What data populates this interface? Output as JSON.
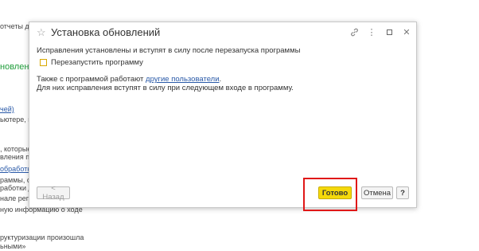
{
  "background": {
    "fragments": [
      {
        "text": "отчеты для",
        "style": "plain"
      },
      {
        "text": "новление",
        "style": "green"
      },
      {
        "text": "чей)",
        "style": "link"
      },
      {
        "text": "ьютере, в с",
        "style": "plain"
      },
      {
        "text": ", которые д",
        "style": "plain"
      },
      {
        "text": "вления прог",
        "style": "plain"
      },
      {
        "text": "обработка",
        "style": "link"
      },
      {
        "text": "раммы, от",
        "style": "plain"
      },
      {
        "text": "работки да",
        "style": "plain"
      },
      {
        "text": "нале регис",
        "style": "plain"
      },
      {
        "text": "ную информацию о ходе",
        "style": "plain"
      },
      {
        "text": "руктуризации произошла",
        "style": "plain"
      },
      {
        "text": "ьными»",
        "style": "plain"
      }
    ]
  },
  "dialog": {
    "title": "Установка обновлений",
    "message_line1": "Исправления установлены и вступят в силу после перезапуска программы",
    "restart_checkbox_label": "Перезапустить программу",
    "restart_checked": false,
    "info_prefix": "Также с программой работают ",
    "info_link": "другие пользователи",
    "info_suffix": ".",
    "info_line2": "Для них исправления вступят в силу при следующем входе в программу.",
    "buttons": {
      "back": "< Назад",
      "done": "Готово",
      "cancel": "Отмена",
      "help": "?"
    }
  },
  "colors": {
    "done_button": "#f5d90a",
    "link": "#2a5aa8",
    "highlight": "#e01818",
    "checkbox_border": "#d8a800"
  }
}
